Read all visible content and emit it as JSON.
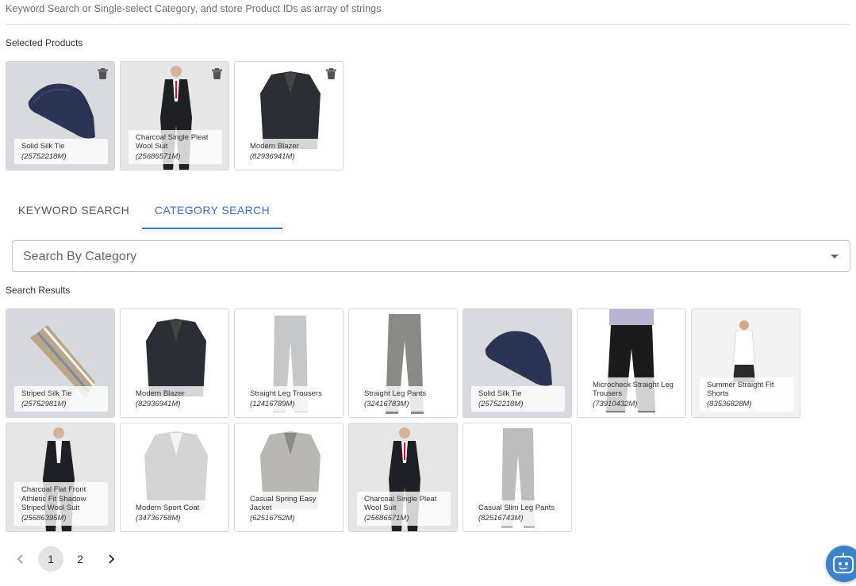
{
  "description": "Keyword Search or Single-select Category, and store Product IDs as array of strings",
  "selected_label": "Selected Products",
  "selected": [
    {
      "name": "Solid Silk Tie",
      "id": "(25752218M)",
      "icon": "tie-image"
    },
    {
      "name": "Charcoal Single Pleat Wool Suit",
      "id": "(25686571M)",
      "icon": "suit-model-image"
    },
    {
      "name": "Modern Blazer",
      "id": "(82936941M)",
      "icon": "blazer-image"
    }
  ],
  "tabs": [
    {
      "label": "KEYWORD SEARCH",
      "active": false
    },
    {
      "label": "CATEGORY SEARCH",
      "active": true
    }
  ],
  "category_select": {
    "placeholder": "Search By Category"
  },
  "results_label": "Search Results",
  "results": [
    {
      "name": "Striped Silk Tie",
      "id": "(25752981M)"
    },
    {
      "name": "Modern Blazer",
      "id": "(82936941M)"
    },
    {
      "name": "Straight Leg Trousers",
      "id": "(12416789M)"
    },
    {
      "name": "Straight Leg Pants",
      "id": "(32416783M)"
    },
    {
      "name": "Solid Silk Tie",
      "id": "(25752218M)"
    },
    {
      "name": "Microcheck Straight Leg Trousers",
      "id": "(73910432M)"
    },
    {
      "name": "Summer Straight Fit Shorts",
      "id": "(83536828M)"
    },
    {
      "name": "Charcoal Flat Front Athletic Fit Shadow Striped Wool Suit",
      "id": "(25686395M)"
    },
    {
      "name": "Modern Sport Coat",
      "id": "(34736758M)"
    },
    {
      "name": "Casual Spring Easy Jacket",
      "id": "(62516752M)"
    },
    {
      "name": "Charcoal Single Pleat Wool Suit",
      "id": "(25686571M)"
    },
    {
      "name": "Casual Slim Leg Pants",
      "id": "(82516743M)"
    }
  ],
  "pagination": {
    "pages": [
      "1",
      "2"
    ],
    "current": "1"
  },
  "colors": {
    "accent": "#3f6fc4",
    "bot": "#3b82c8"
  }
}
